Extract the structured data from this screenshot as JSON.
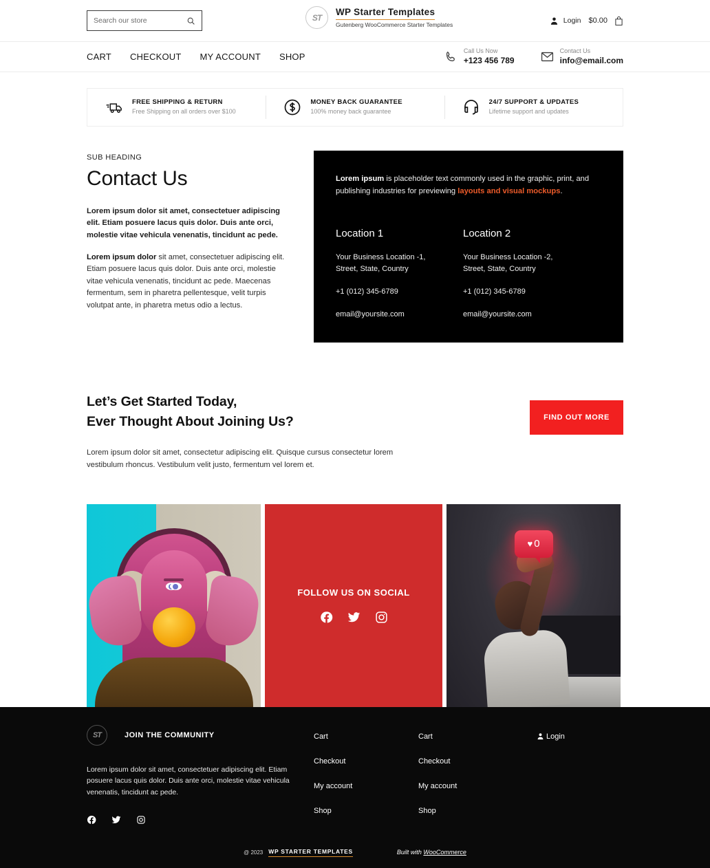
{
  "header": {
    "search": {
      "placeholder": "Search our store",
      "value": "",
      "icon": "search-icon"
    },
    "brand": {
      "mark": "ST",
      "title": "WP Starter Templates",
      "subtitle": "Gutenberg WooCommerce Starter Templates"
    },
    "account": {
      "login_label": "Login",
      "cart_total": "$0.00",
      "person_icon": "person-icon",
      "bag_icon": "shopping-bag-icon"
    }
  },
  "nav": {
    "links": [
      "CART",
      "CHECKOUT",
      "MY ACCOUNT",
      "SHOP"
    ],
    "contacts": [
      {
        "icon": "phone-icon",
        "top": "Call Us Now",
        "main": "+123 456 789"
      },
      {
        "icon": "envelope-icon",
        "top": "Contact Us",
        "main": "info@email.com"
      }
    ]
  },
  "features": [
    {
      "icon": "truck-icon",
      "title": "FREE SHIPPING & RETURN",
      "sub": "Free Shipping on all orders over $100"
    },
    {
      "icon": "dollar-circle-icon",
      "title": "MONEY BACK GUARANTEE",
      "sub": "100% money back guarantee"
    },
    {
      "icon": "headset-support-icon",
      "title": "24/7 SUPPORT & UPDATES",
      "sub": "Lifetime support and updates"
    }
  ],
  "contact_section": {
    "sub_heading": "SUB HEADING",
    "title": "Contact Us",
    "paragraph1": "Lorem ipsum dolor sit amet, consectetuer adipiscing elit. Etiam posuere lacus quis dolor. Duis ante orci, molestie vitae vehicula venenatis, tincidunt ac pede.",
    "paragraph2_bold": "Lorem ipsum dolor",
    "paragraph2_rest": " sit amet, consectetuer adipiscing elit. Etiam posuere lacus quis dolor. Duis ante orci, molestie vitae vehicula venenatis, tincidunt ac pede. Maecenas fermentum, sem in pharetra pellentesque, velit turpis volutpat ante, in pharetra metus odio a lectus.",
    "card": {
      "intro_bold": "Lorem ipsum",
      "intro_mid": " is placeholder text commonly used in the graphic, print, and publishing industries for previewing ",
      "intro_accent": "layouts and visual mockups",
      "intro_end": ".",
      "accent_color": "#ec5b2a",
      "background": "#000000",
      "locations": [
        {
          "heading": "Location 1",
          "address_line1": "Your Business Location -1,",
          "address_line2": "Street, State, Country",
          "phone": "+1 (012) 345-6789",
          "email": "email@yoursite.com"
        },
        {
          "heading": "Location 2",
          "address_line1": "Your Business Location -2,",
          "address_line2": "Street, State, Country",
          "phone": "+1 (012) 345-6789",
          "email": "email@yoursite.com"
        }
      ]
    }
  },
  "cta": {
    "heading_line1": "Let’s Get Started Today,",
    "heading_line2": "Ever Thought About Joining Us?",
    "paragraph": "Lorem ipsum dolor sit amet, consectetur adipiscing elit. Quisque cursus consectetur lorem vestibulum rhoncus. Vestibulum velit justo, fermentum vel lorem et.",
    "button_label": "FIND OUT MORE",
    "button_color": "#f22020"
  },
  "gallery": {
    "left_image_alt": "woman with headphones blowing yellow bubblegum",
    "right_image_alt": "woman reaching toward glowing like notification",
    "social_panel": {
      "title": "FOLLOW US ON SOCIAL",
      "background": "#cf2c2c",
      "icons": [
        "facebook-icon",
        "twitter-icon",
        "instagram-icon"
      ]
    }
  },
  "footer": {
    "mark": "ST",
    "join_title": "JOIN THE COMMUNITY",
    "description": "Lorem ipsum dolor sit amet, consectetuer adipiscing elit. Etiam posuere lacus quis dolor. Duis ante orci, molestie vitae vehicula venenatis, tincidunt ac pede.",
    "social_icons": [
      "facebook-icon",
      "twitter-icon",
      "instagram-icon"
    ],
    "column_a": [
      "Cart",
      "Checkout",
      "My account",
      "Shop"
    ],
    "column_b": [
      "Cart",
      "Checkout",
      "My account",
      "Shop"
    ],
    "login_label": "Login",
    "bottom": {
      "copyright": "@ 2023",
      "site_name": "WP STARTER TEMPLATES",
      "built_with_prefix": "Built with ",
      "built_with_link": "WooCommerce",
      "underline_color": "#d98b2b"
    }
  }
}
